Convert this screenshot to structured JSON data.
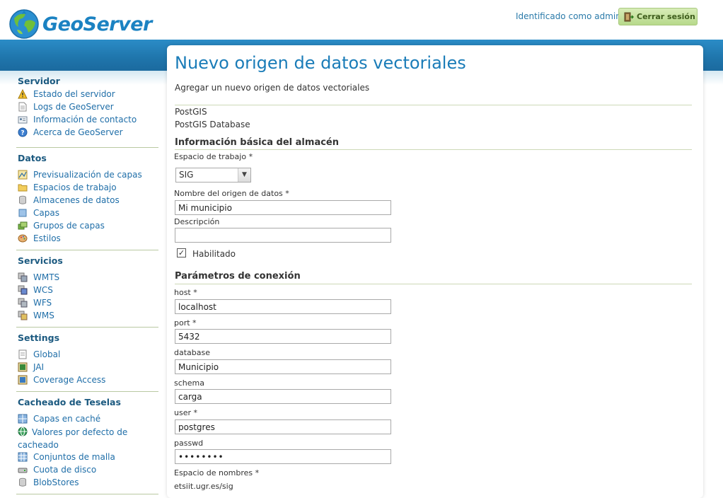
{
  "header": {
    "logo_text": "GeoServer",
    "login_status": "Identificado como admin.",
    "logout_label": "Cerrar sesión"
  },
  "sidebar": {
    "sections": [
      {
        "title": "Servidor",
        "items": [
          "Estado del servidor",
          "Logs de GeoServer",
          "Información de contacto",
          "Acerca de GeoServer"
        ]
      },
      {
        "title": "Datos",
        "items": [
          "Previsualización de capas",
          "Espacios de trabajo",
          "Almacenes de datos",
          "Capas",
          "Grupos de capas",
          "Estilos"
        ]
      },
      {
        "title": "Servicios",
        "items": [
          "WMTS",
          "WCS",
          "WFS",
          "WMS"
        ]
      },
      {
        "title": "Settings",
        "items": [
          "Global",
          "JAI",
          "Coverage Access"
        ]
      },
      {
        "title": "Cacheado de Teselas",
        "items": [
          "Capas en caché",
          "Valores por defecto de cacheado",
          "Conjuntos de malla",
          "Cuota de disco",
          "BlobStores"
        ]
      }
    ]
  },
  "page": {
    "title": "Nuevo origen de datos vectoriales",
    "subtitle": "Agregar un nuevo origen de datos vectoriales",
    "store_type": "PostGIS",
    "store_type_desc": "PostGIS Database"
  },
  "basic": {
    "heading": "Información básica del almacén",
    "workspace_label": "Espacio de trabajo *",
    "workspace_value": "SIG",
    "name_label": "Nombre del origen de datos *",
    "name_value": "Mi municipio",
    "description_label": "Descripción",
    "description_value": "",
    "enabled_label": "Habilitado",
    "enabled_mark": "✓"
  },
  "connection": {
    "heading": "Parámetros de conexión",
    "host_label": "host *",
    "host_value": "localhost",
    "port_label": "port *",
    "port_value": "5432",
    "database_label": "database",
    "database_value": "Municipio",
    "schema_label": "schema",
    "schema_value": "carga",
    "user_label": "user *",
    "user_value": "postgres",
    "passwd_label": "passwd",
    "passwd_value": "••••••••",
    "namespace_label": "Espacio de nombres *",
    "namespace_value": "etsiit.ugr.es/sig"
  }
}
